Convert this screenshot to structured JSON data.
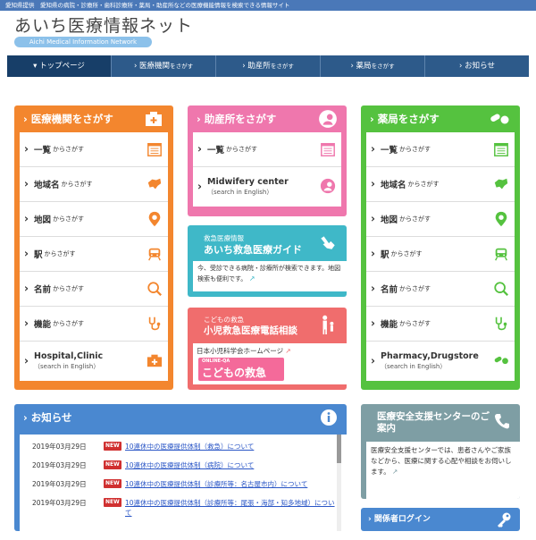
{
  "topbar": {
    "text": "愛知県提供　愛知県の病院・診療所・歯科診療所・薬局・助産所などの医療機能情報を検索できる情報サイト"
  },
  "brand": {
    "title": "あいち医療情報ネット",
    "subtitle": "Aichi Medical Information Network"
  },
  "nav": [
    {
      "label": "トップページ",
      "small": ""
    },
    {
      "label": "医療機関",
      "small": "をさがす"
    },
    {
      "label": "助産所",
      "small": "をさがす"
    },
    {
      "label": "薬局",
      "small": "をさがす"
    },
    {
      "label": "お知らせ",
      "small": ""
    }
  ],
  "medical": {
    "title": "医療機関をさがす",
    "rows": [
      {
        "label": "一覧",
        "small": "からさがす"
      },
      {
        "label": "地域名",
        "small": "からさがす"
      },
      {
        "label": "地図",
        "small": "からさがす"
      },
      {
        "label": "駅",
        "small": "からさがす"
      },
      {
        "label": "名前",
        "small": "からさがす"
      },
      {
        "label": "機能",
        "small": "からさがす"
      }
    ],
    "english": {
      "label": "Hospital,Clinic",
      "sub": "（search in English）"
    }
  },
  "midwife": {
    "title": "助産所をさがす",
    "rows": [
      {
        "label": "一覧",
        "small": "からさがす"
      }
    ],
    "english": {
      "label": "Midwifery center",
      "sub": "（search in English）"
    }
  },
  "pharmacy": {
    "title": "薬局をさがす",
    "rows": [
      {
        "label": "一覧",
        "small": "からさがす"
      },
      {
        "label": "地域名",
        "small": "からさがす"
      },
      {
        "label": "地図",
        "small": "からさがす"
      },
      {
        "label": "駅",
        "small": "からさがす"
      },
      {
        "label": "名前",
        "small": "からさがす"
      },
      {
        "label": "機能",
        "small": "からさがす"
      }
    ],
    "english": {
      "label": "Pharmacy,Drugstore",
      "sub": "（search in English）"
    }
  },
  "emergency": {
    "small": "救急医療情報",
    "title": "あいち救急医療ガイド",
    "desc": "今、受診できる病院・診療所が検索できます。地図検索も便利です。"
  },
  "child": {
    "small": "こどもの救急",
    "title": "小児救急医療電話相談",
    "link": "日本小児科学会ホームページ",
    "banner_small": "ONLINE-QA",
    "banner": "こどもの救急"
  },
  "news": {
    "title": "お知らせ",
    "badge": "NEW",
    "items": [
      {
        "date": "2019年03月29日",
        "text": "10連休中の医療提供体制（救急）について"
      },
      {
        "date": "2019年03月29日",
        "text": "10連休中の医療提供体制（病院）について"
      },
      {
        "date": "2019年03月29日",
        "text": "10連休中の医療提供体制（診療所等：名古屋市内）について"
      },
      {
        "date": "2019年03月29日",
        "text": "10連休中の医療提供体制（診療所等：尾張・海部・知多地域）について"
      }
    ]
  },
  "safety": {
    "title": "医療安全支援センターのご案内",
    "desc": "医療安全支援センターでは、患者さんやご家族などから、医療に関する心配や相談をお伺いします。"
  },
  "login": {
    "label": "関係者ログイン"
  },
  "colors": {
    "orange": "#f3862e",
    "pink": "#ef77ad",
    "green": "#55c23f",
    "teal": "#3fb8c8",
    "coral": "#f06d6d",
    "blue": "#4a88d0",
    "slate": "#7e9ea4",
    "navy": "#2d5a8a"
  }
}
